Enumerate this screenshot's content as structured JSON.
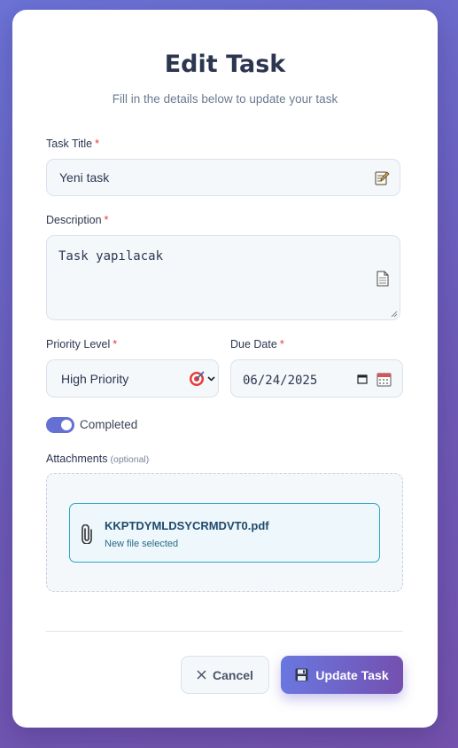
{
  "header": {
    "title": "Edit Task",
    "subtitle": "Fill in the details below to update your task"
  },
  "form": {
    "task_title": {
      "label": "Task Title",
      "required": "*",
      "value": "Yeni task",
      "icon": "memo-icon"
    },
    "description": {
      "label": "Description",
      "required": "*",
      "value": "Task yapılacak",
      "icon": "page-icon"
    },
    "priority": {
      "label": "Priority Level",
      "required": "*",
      "value": "High Priority",
      "icon": "target-icon"
    },
    "due_date": {
      "label": "Due Date",
      "required": "*",
      "value": "06/24/2025",
      "icon": "calendar-icon"
    },
    "completed": {
      "label": "Completed",
      "checked": true
    },
    "attachments": {
      "label": "Attachments",
      "optional": "(optional)",
      "file_name": "KKPTDYMLDSYCRMDVT0.pdf",
      "file_status": "New file selected",
      "icon": "paperclip-icon"
    }
  },
  "actions": {
    "cancel_label": "Cancel",
    "update_label": "Update Task"
  },
  "colors": {
    "accent": "#6470d4",
    "required": "#e03b3b",
    "file_border": "#2aa8c6"
  }
}
